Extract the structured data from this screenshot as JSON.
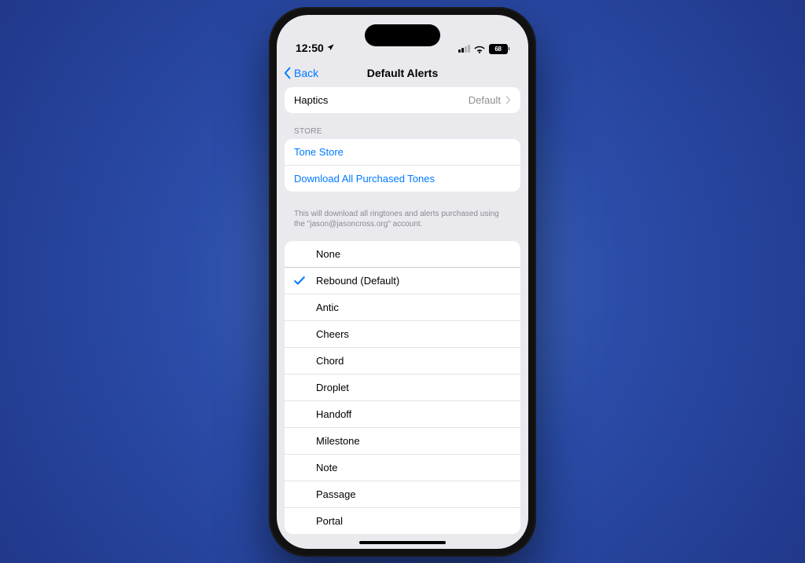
{
  "status_bar": {
    "time": "12:50",
    "battery": "68"
  },
  "nav": {
    "back_label": "Back",
    "title": "Default Alerts"
  },
  "haptics": {
    "label": "Haptics",
    "value": "Default"
  },
  "store": {
    "header": "STORE",
    "tone_store": "Tone Store",
    "download_all": "Download All Purchased Tones",
    "footer": "This will download all ringtones and alerts purchased using the \"jason@jasoncross.org\" account."
  },
  "tones": {
    "none": "None",
    "selected": "Rebound (Default)",
    "items": [
      "Antic",
      "Cheers",
      "Chord",
      "Droplet",
      "Handoff",
      "Milestone",
      "Note",
      "Passage",
      "Portal"
    ]
  }
}
